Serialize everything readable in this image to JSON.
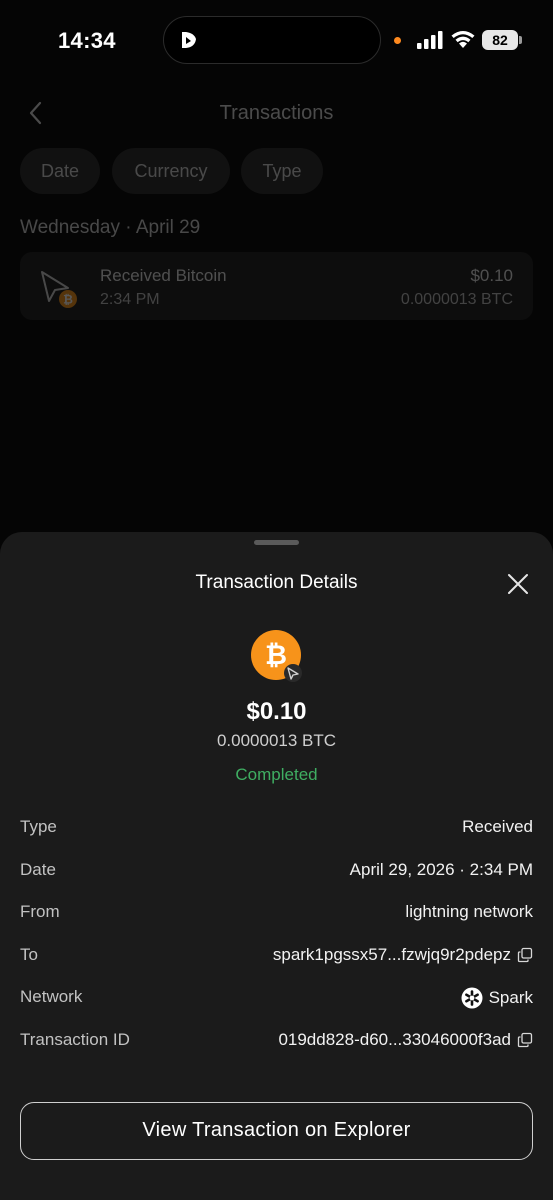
{
  "status_bar": {
    "time": "14:34",
    "battery": "82"
  },
  "background": {
    "title": "Transactions",
    "filters": [
      "Date",
      "Currency",
      "Type"
    ],
    "section_date": "Wednesday · April 29",
    "transaction": {
      "title": "Received Bitcoin",
      "time": "2:34 PM",
      "fiat": "$0.10",
      "btc": "0.0000013 BTC"
    }
  },
  "sheet": {
    "title": "Transaction Details",
    "amount": "$0.10",
    "amount_btc": "0.0000013 BTC",
    "status": "Completed",
    "details": [
      {
        "label": "Type",
        "value": "Received"
      },
      {
        "label": "Date",
        "value": "April 29, 2026 · 2:34 PM"
      },
      {
        "label": "From",
        "value": "lightning network"
      },
      {
        "label": "To",
        "value": "spark1pgssx57...fzwjq9r2pdepz"
      },
      {
        "label": "Network",
        "value": "Spark"
      },
      {
        "label": "Transaction ID",
        "value": "019dd828-d60...33046000f3ad"
      }
    ],
    "explorer_button": "View Transaction on Explorer"
  },
  "colors": {
    "bitcoin_orange": "#f7931a",
    "completed_green": "#3fae62",
    "sheet_background": "#1b1b1b"
  }
}
